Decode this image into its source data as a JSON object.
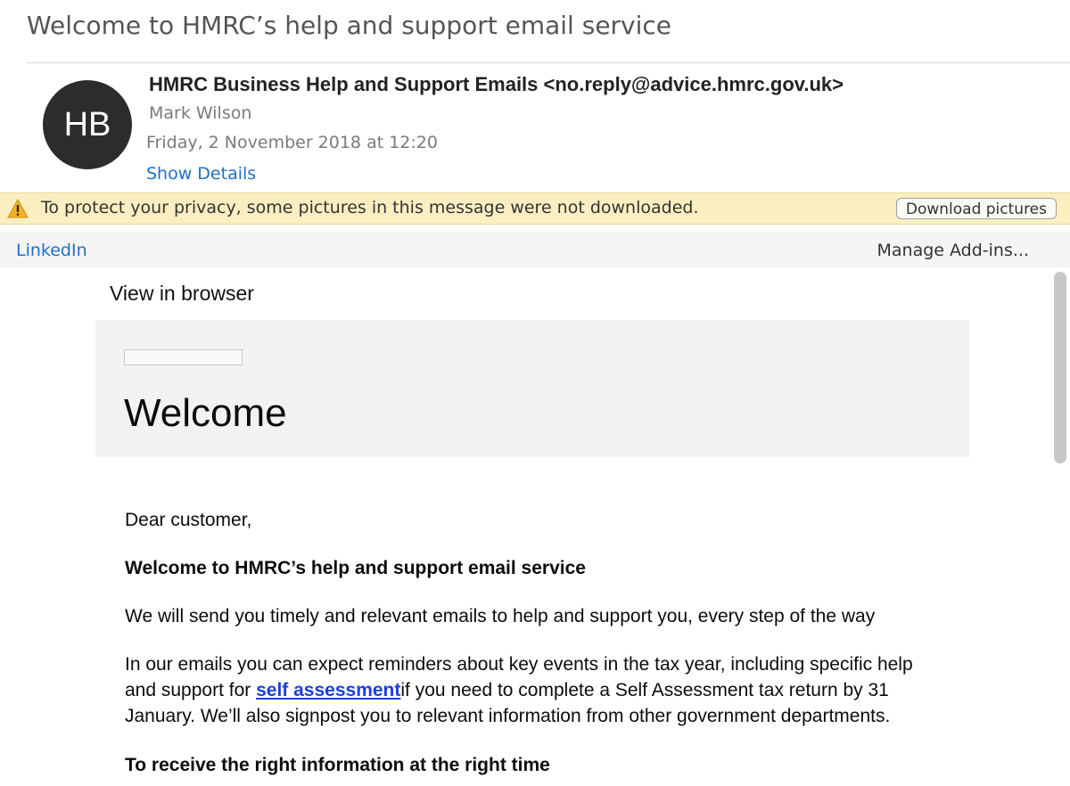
{
  "email": {
    "subject": "Welcome to HMRC’s help and support email service",
    "avatar_initials": "HB",
    "from": "HMRC Business Help and Support Emails <no.reply@advice.hmrc.gov.uk>",
    "to": "Mark Wilson",
    "date": "Friday, 2 November 2018 at 12:20",
    "show_details": "Show Details"
  },
  "privacy_bar": {
    "icon": "warning-icon",
    "message": "To protect your privacy, some pictures in this message were not downloaded.",
    "download_button": "Download pictures"
  },
  "addins_bar": {
    "linkedin": "LinkedIn",
    "manage": "Manage Add-ins..."
  },
  "body": {
    "view_in_browser": "View in browser",
    "welcome_heading": "Welcome",
    "greeting": "Dear customer,",
    "heading1": "Welcome to HMRC’s help and support email service",
    "para1": "We will send you timely and relevant emails to help and support you, every step of the way",
    "para2_before": "In our emails you can expect reminders about key events in the tax year, including specific help and support for ",
    "para2_link": "self assessment",
    "para2_after": "if you need to complete a Self Assessment tax return by 31 January. We’ll also signpost you to relevant information from other government departments.",
    "heading2": "To receive the right information at the right time"
  },
  "colors": {
    "link_blue": "#1f6fc5",
    "body_link": "#1d3ed6",
    "privacy_bar_bg": "#fbefc2",
    "avatar_bg": "#2c2c2c"
  }
}
